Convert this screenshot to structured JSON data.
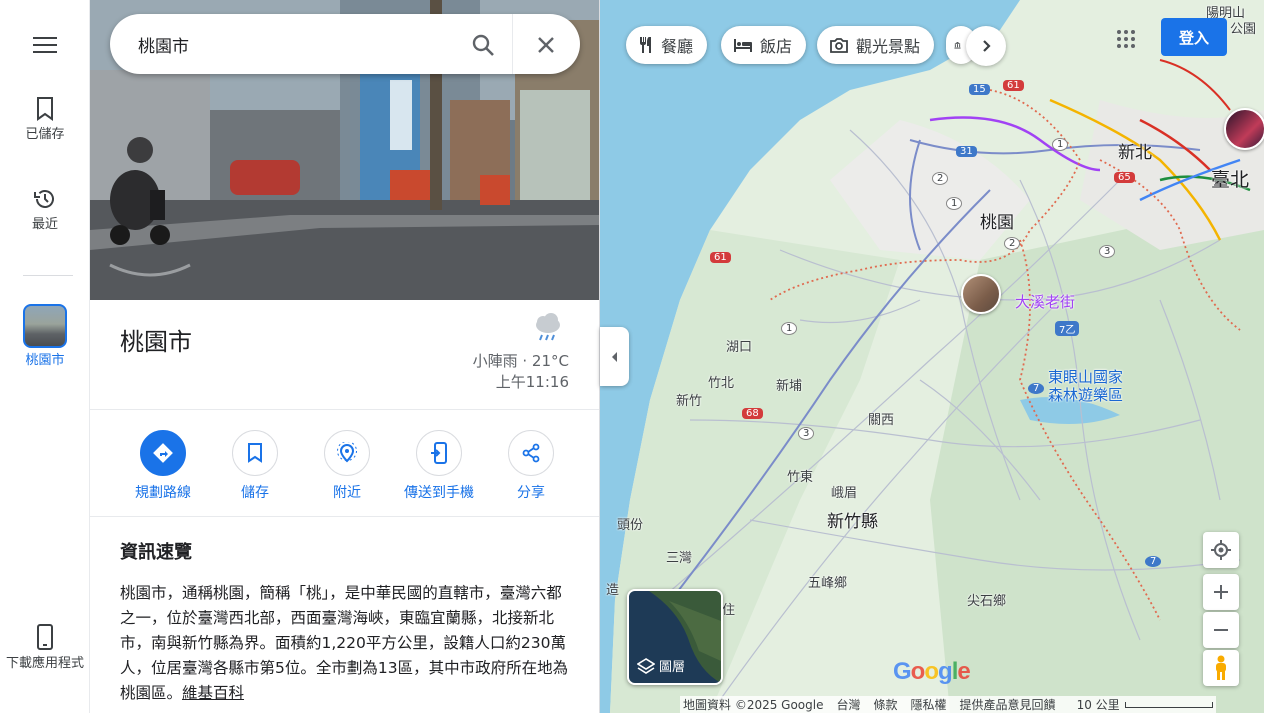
{
  "rail": {
    "saved_label": "已儲存",
    "recent_label": "最近",
    "place_label": "桃園市",
    "download_label": "下載應用程式"
  },
  "search": {
    "value": "桃園市"
  },
  "place": {
    "title": "桃園市",
    "weather_desc": "小陣雨 · 21°C",
    "weather_time": "上午11:16"
  },
  "actions": [
    {
      "label": "規劃路線",
      "icon": "directions-icon"
    },
    {
      "label": "儲存",
      "icon": "bookmark-icon"
    },
    {
      "label": "附近",
      "icon": "nearby-icon"
    },
    {
      "label": "傳送到手機",
      "icon": "send-to-phone-icon"
    },
    {
      "label": "分享",
      "icon": "share-icon"
    }
  ],
  "overview": {
    "heading": "資訊速覽",
    "text": "桃園市，通稱桃園，簡稱「桃」，是中華民國的直轄市，臺灣六都之一，位於臺灣西北部，西面臺灣海峽，東臨宜蘭縣，北接新北市，南與新竹縣為界。面積約1,220平方公里，設籍人口約230萬人，位居臺灣各縣市第5位。全市劃為13區，其中市政府所在地為桃園區。",
    "wiki_link": "維基百科"
  },
  "chips": [
    "餐廳",
    "飯店",
    "觀光景點"
  ],
  "header": {
    "signin": "登入"
  },
  "layers": {
    "label": "圖層"
  },
  "map_labels": {
    "yangmingshan": "陽明山",
    "park": "公園",
    "xinbei": "新北",
    "taibei": "臺北",
    "taoyuan": "桃園",
    "daxi": "大溪老街",
    "hukou": "湖口",
    "zhubei": "竹北",
    "xinpu": "新埔",
    "xinzhu": "新竹",
    "guanxi": "關西",
    "dongyanshan": "東眼山國家",
    "forest": "森林遊樂區",
    "zhudong": "竹東",
    "emei": "峨眉",
    "xinzhu_county": "新竹縣",
    "toufen": "頭份",
    "sanwan": "三灣",
    "wufeng": "五峰鄉",
    "jianshi": "尖石鄉",
    "zao": "造",
    "zhu": "住"
  },
  "road_shields": {
    "r1": "1",
    "r2": "2",
    "r3": "3",
    "r7": "7",
    "r15": "15",
    "r31": "31",
    "r61": "61",
    "r65": "65",
    "r68": "68",
    "r7yi": "7乙"
  },
  "footer": {
    "map_data": "地圖資料 ©2025 Google",
    "taiwan": "台灣",
    "terms": "條款",
    "privacy": "隱私權",
    "feedback": "提供產品意見回饋",
    "scale": "10 公里"
  },
  "colors": {
    "accent": "#1a73e8",
    "sea": "#8ecae6",
    "land": "#e4efe0",
    "border": "#d93025"
  }
}
